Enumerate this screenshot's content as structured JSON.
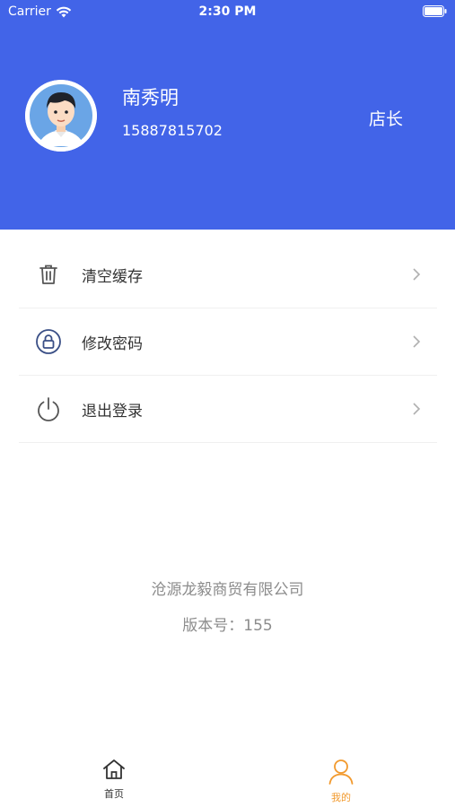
{
  "status_bar": {
    "carrier": "Carrier",
    "time": "2:30 PM"
  },
  "profile": {
    "name": "南秀明",
    "phone": "15887815702",
    "role": "店长"
  },
  "menu": [
    {
      "label": "清空缓存",
      "icon": "trash-icon"
    },
    {
      "label": "修改密码",
      "icon": "lock-icon"
    },
    {
      "label": "退出登录",
      "icon": "power-icon"
    }
  ],
  "footer": {
    "company": "沧源龙毅商贸有限公司",
    "version": "版本号：155"
  },
  "tabbar": [
    {
      "label": "首页",
      "icon": "home-icon",
      "active": false
    },
    {
      "label": "我的",
      "icon": "user-icon",
      "active": true
    }
  ],
  "colors": {
    "header": "#4264e8",
    "active_tab": "#f29a2e",
    "muted_text": "#8c8c8c"
  }
}
